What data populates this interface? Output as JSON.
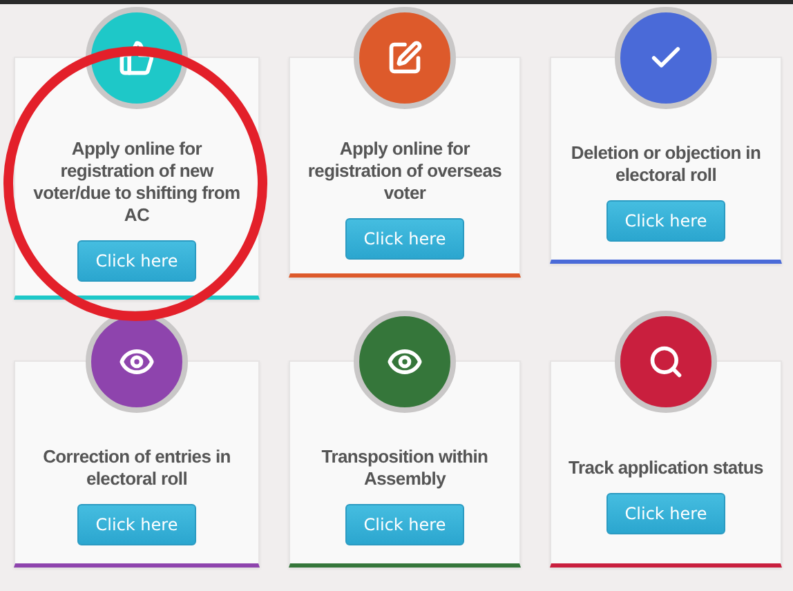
{
  "cards": [
    {
      "title": "Apply online for registration of new voter/due to shifting from AC",
      "button": "Click here",
      "color": "#1ec8c8"
    },
    {
      "title": "Apply online for registration of overseas voter",
      "button": "Click here",
      "color": "#dd5a2b"
    },
    {
      "title": "Deletion or objection in electoral roll",
      "button": "Click here",
      "color": "#4a6ad8"
    },
    {
      "title": "Correction of entries in electoral roll",
      "button": "Click here",
      "color": "#8e44ad"
    },
    {
      "title": "Transposition within Assembly",
      "button": "Click here",
      "color": "#35763a"
    },
    {
      "title": "Track application status",
      "button": "Click here",
      "color": "#c91f3e"
    }
  ]
}
